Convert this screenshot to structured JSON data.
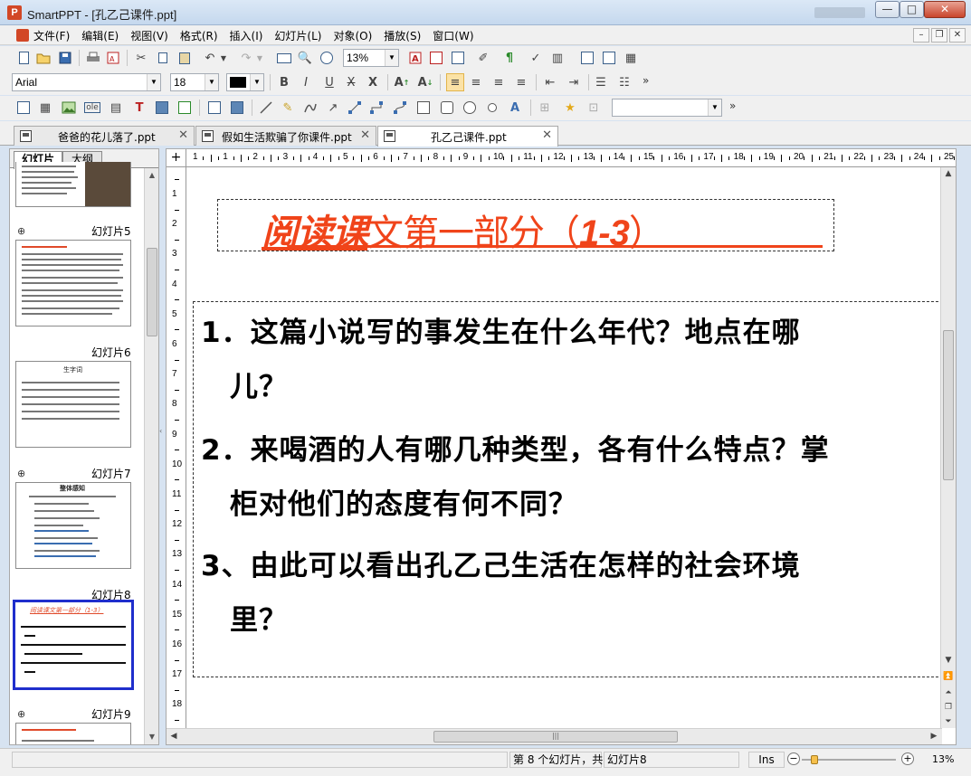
{
  "window": {
    "title": "SmartPPT - [孔乙己课件.ppt]",
    "app_icon": "powerpoint-icon",
    "buttons": [
      "—",
      "□",
      "✕"
    ]
  },
  "menu": {
    "items": [
      "文件(F)",
      "编辑(E)",
      "视图(V)",
      "格式(R)",
      "插入(I)",
      "幻灯片(L)",
      "对象(O)",
      "播放(S)",
      "窗口(W)"
    ],
    "mdi_buttons": [
      "–",
      "❐",
      "✕"
    ]
  },
  "toolbar": {
    "zoom_value": "13%",
    "font_name": "Arial",
    "font_size": "18",
    "font_color": "#000000",
    "more": "»"
  },
  "tabs": [
    {
      "label": "爸爸的花儿落了.ppt",
      "active": false
    },
    {
      "label": "假如生活欺骗了你课件.ppt",
      "active": false
    },
    {
      "label": "孔乙己课件.ppt",
      "active": true
    }
  ],
  "left_panel": {
    "tabs": [
      "幻灯片",
      "大纲"
    ],
    "slides": [
      {
        "label": "幻灯片5"
      },
      {
        "label": "幻灯片6",
        "title": "生字词"
      },
      {
        "label": "幻灯片7",
        "title": "整体感知"
      },
      {
        "label": "幻灯片8",
        "title": "阅读课文第一部分（1-3）"
      },
      {
        "label": "幻灯片9"
      }
    ]
  },
  "ruler": {
    "h_labels": [
      "1",
      "1",
      "2",
      "3",
      "4",
      "5",
      "6",
      "7",
      "8",
      "9",
      "10",
      "11",
      "12",
      "13",
      "14",
      "15",
      "16",
      "17",
      "18",
      "19",
      "20",
      "21",
      "22",
      "23",
      "24",
      "25"
    ],
    "v_labels": [
      "1",
      "2",
      "3",
      "4",
      "5",
      "6",
      "7",
      "8",
      "9",
      "10",
      "11",
      "12",
      "13",
      "14",
      "15",
      "16",
      "17",
      "18"
    ]
  },
  "slide": {
    "title_part1": "阅读课",
    "title_part2": "文第一部分（",
    "title_part3": "1-3",
    "title_part4": "）",
    "lines": [
      "1．这篇小说写的事发生在什么年代？地点在哪",
      "儿？",
      "2．来喝酒的人有哪几种类型，各有什么特点？掌",
      "柜对他们的态度有何不同？",
      "3、由此可以看出孔乙己生活在怎样的社会环境",
      "里？"
    ]
  },
  "status": {
    "slide_info": "第 8 个幻灯片，共",
    "slide_name": "幻灯片8",
    "ins": "Ins",
    "zoom": "13%",
    "zoom_level_fraction": 0.1
  },
  "colors": {
    "title_red": "#f0441a",
    "selected_thumb_border": "#1f2ecc"
  }
}
